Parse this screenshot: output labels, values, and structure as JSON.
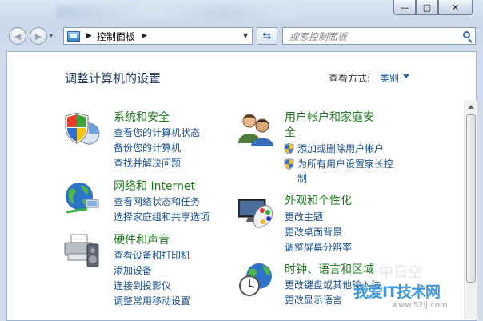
{
  "window": {
    "min_glyph": "—",
    "max_glyph": "▢",
    "close_glyph": "✕"
  },
  "nav": {
    "back_glyph": "◀",
    "forward_glyph": "▶",
    "recent_glyph": "▾"
  },
  "address": {
    "location": "控制面板",
    "refresh_glyph": "⇆"
  },
  "search": {
    "placeholder": "搜索控制面板"
  },
  "page": {
    "title": "调整计算机的设置",
    "view_label": "查看方式:",
    "view_mode": "类别"
  },
  "categories": [
    {
      "id": "system",
      "title": "系统和安全",
      "icon": "shield-pie-icon",
      "links": [
        "查看您的计算机状态",
        "备份您的计算机",
        "查找并解决问题"
      ]
    },
    {
      "id": "network",
      "title": "网络和 Internet",
      "icon": "globe-network-icon",
      "links": [
        "查看网络状态和任务",
        "选择家庭组和共享选项"
      ]
    },
    {
      "id": "hardware",
      "title": "硬件和声音",
      "icon": "printer-speaker-icon",
      "links": [
        "查看设备和打印机",
        "添加设备",
        "连接到投影仪",
        "调整常用移动设置"
      ]
    },
    {
      "id": "users",
      "title_line1": "用户帐户和家庭安",
      "title_line2": "全",
      "icon": "users-icon",
      "links": [
        "添加或删除用户帐户",
        "为所有用户设置家长控",
        "制"
      ]
    },
    {
      "id": "appearance",
      "title": "外观和个性化",
      "icon": "display-palette-icon",
      "links": [
        "更改主题",
        "更改桌面背景",
        "调整屏幕分辨率"
      ]
    },
    {
      "id": "clock",
      "title": "时钟、语言和区域",
      "icon": "clock-globe-icon",
      "links": [
        "更改键盘或其他输入法",
        "更改显示语言"
      ]
    }
  ],
  "watermark": {
    "text": "我爱IT技术网",
    "url": "www.52ij.com",
    "ghost": "中日空"
  }
}
